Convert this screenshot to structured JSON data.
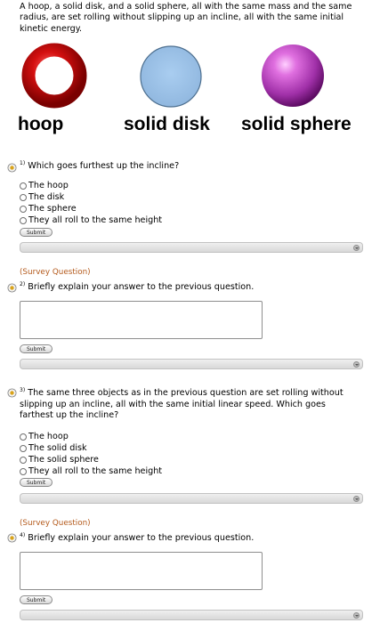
{
  "intro": "A hoop, a solid disk, and a solid sphere, all with the same mass and the same radius, are set rolling without slipping up an incline, all with the same initial kinetic energy.",
  "objects": [
    {
      "label": "hoop",
      "color": "#d01010",
      "icon": "hoop-ring"
    },
    {
      "label": "solid disk",
      "color": "#9cc1e6",
      "icon": "solid-disk-circle"
    },
    {
      "label": "solid sphere",
      "color": "#b844b8",
      "icon": "solid-sphere-ball"
    }
  ],
  "accent_survey_color": "#b45a1c",
  "questions": [
    {
      "number": "1)",
      "text": "Which goes furthest up the incline?",
      "choices": [
        "The hoop",
        "The disk",
        "The sphere",
        "They all roll to the same height"
      ],
      "submit": "Submit"
    },
    {
      "tag": "(Survey Question)",
      "number": "2)",
      "text": "Briefly explain your answer to the previous question.",
      "answer": "",
      "submit": "Submit"
    },
    {
      "number": "3)",
      "text": "The same three objects as in the previous question are set rolling without slipping up an incline, all with the same initial linear speed. Which goes farthest up the incline?",
      "choices": [
        "The hoop",
        "The solid disk",
        "The solid sphere",
        "They all roll to the same height"
      ],
      "submit": "Submit"
    },
    {
      "tag": "(Survey Question)",
      "number": "4)",
      "text": "Briefly explain your answer to the previous question.",
      "answer": "",
      "submit": "Submit"
    }
  ]
}
